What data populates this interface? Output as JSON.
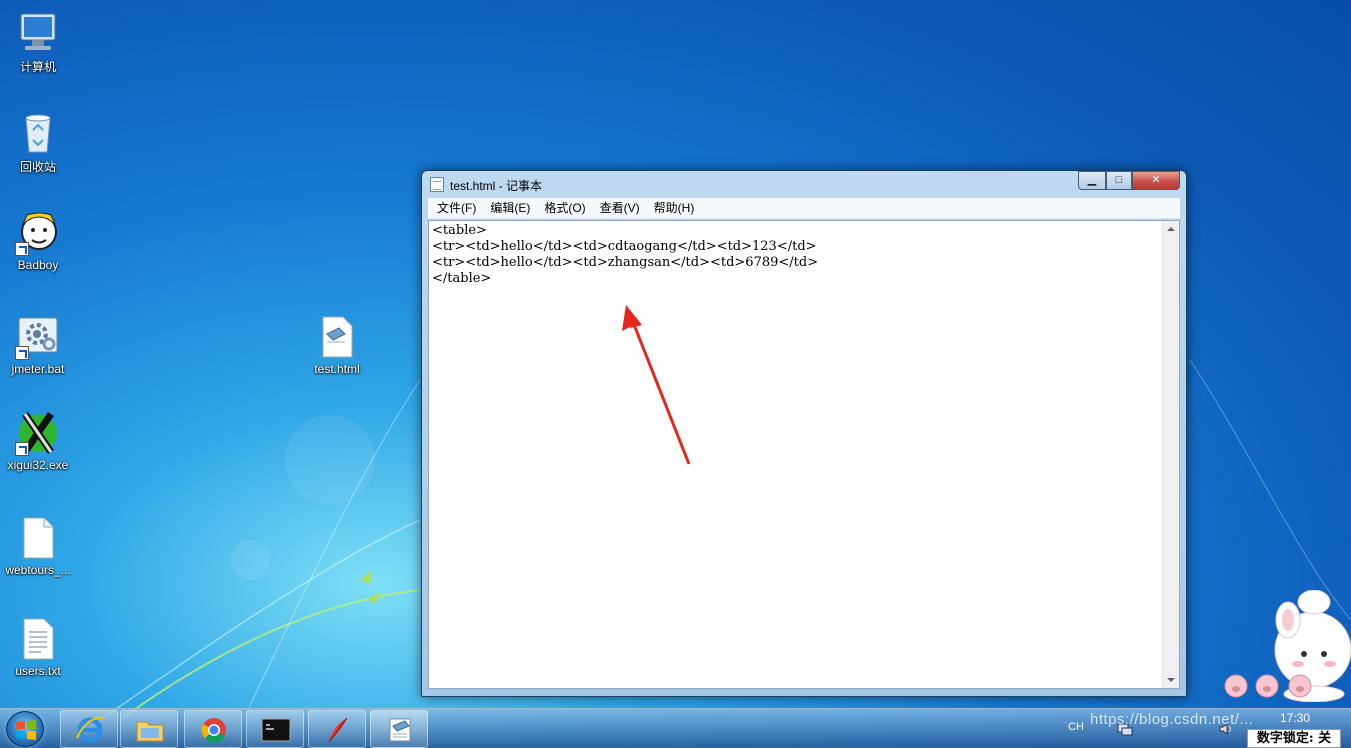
{
  "desktop": {
    "icons": [
      {
        "label": "计算机"
      },
      {
        "label": "回收站"
      },
      {
        "label": "Badboy"
      },
      {
        "label": "jmeter.bat"
      },
      {
        "label": "xigui32.exe"
      },
      {
        "label": "webtours_..."
      },
      {
        "label": "users.txt"
      },
      {
        "label": "test.html"
      }
    ]
  },
  "window": {
    "title": "test.html - 记事本",
    "min_glyph": "▁",
    "max_glyph": "□",
    "close_glyph": "✕",
    "menu": [
      "文件(F)",
      "编辑(E)",
      "格式(O)",
      "查看(V)",
      "帮助(H)"
    ],
    "content": "<table>\n<tr><td>hello</td><td>cdtaogang</td><td>123</td>\n<tr><td>hello</td><td>zhangsan</td><td>6789</td>\n</table>"
  },
  "taskbar": {
    "items": [
      "internet-explorer",
      "file-explorer",
      "chrome",
      "cmd",
      "feather-app",
      "notepad"
    ],
    "tray_lang": "CH",
    "watermark": "https://blog.csdn.net/...",
    "clock": "17:30",
    "numlock": "数字锁定: 关"
  },
  "colors": {
    "annotation_arrow": "#e8261c",
    "close_button": "#c75050"
  }
}
